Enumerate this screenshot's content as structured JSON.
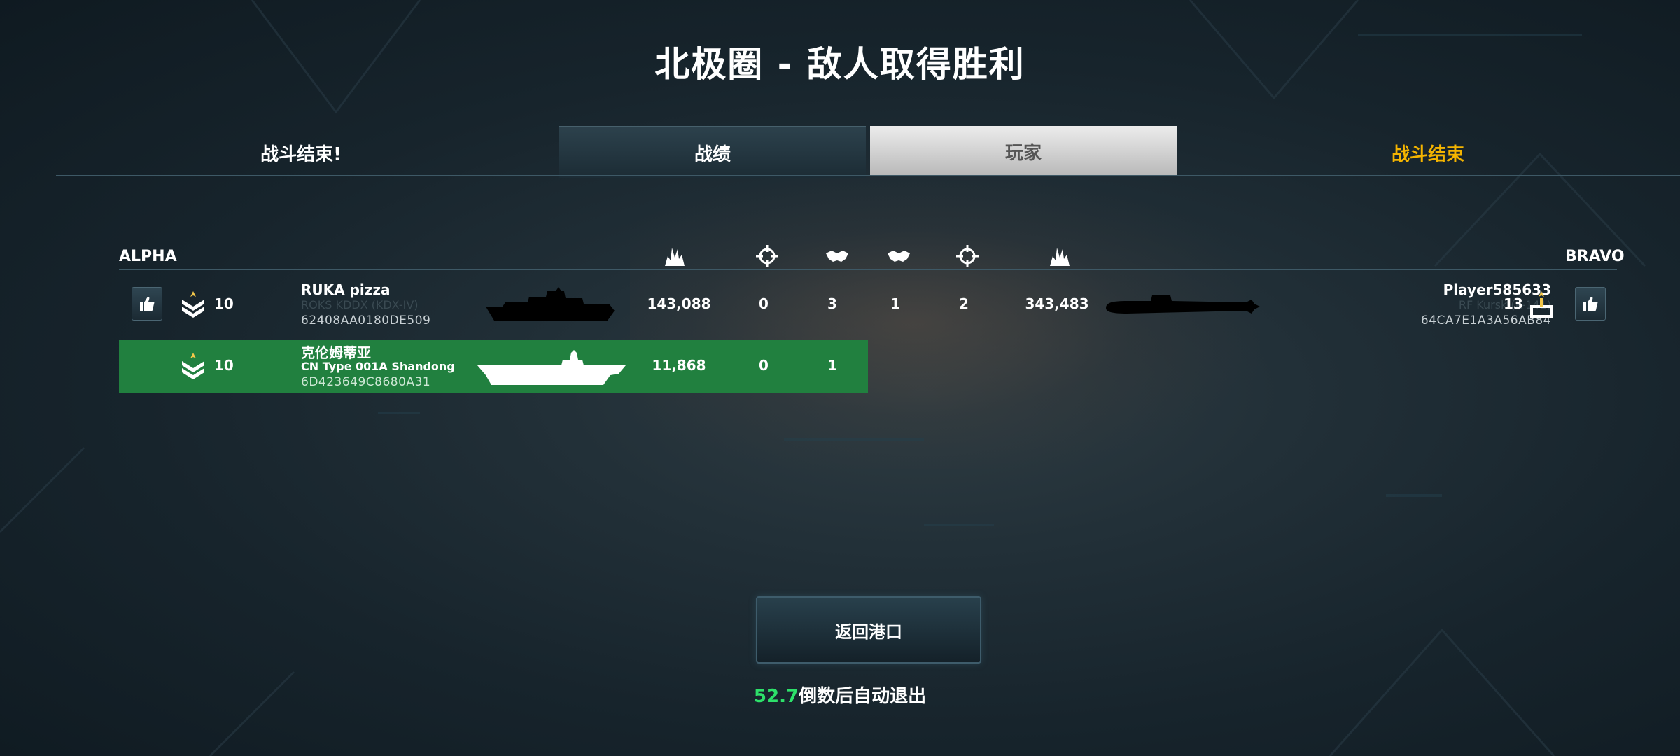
{
  "title": "北极圈 - 敌人取得胜利",
  "tabs_bar": {
    "left_label": "战斗结束!",
    "tab_stats": "战绩",
    "tab_players": "玩家",
    "right_label": "战斗结束"
  },
  "table": {
    "team_left": "ALPHA",
    "team_right": "BRAVO",
    "header_icons": [
      "damage-icon",
      "crosshair-icon",
      "handshake-icon",
      "handshake-icon",
      "crosshair-icon",
      "damage-icon"
    ],
    "rows": [
      {
        "left": {
          "rank": "10",
          "name": "RUKA pizza",
          "ship": "ROKS KDDX (KDX-IV)",
          "id": "62408AA0180DE509",
          "damage": "143,088",
          "kills": "0",
          "assists": "3"
        },
        "right": {
          "assists": "1",
          "kills": "2",
          "damage": "343,483",
          "name": "Player585633",
          "ship": "RF Kursk (K-141)",
          "id": "64CA7E1A3A56AB84",
          "rank": "13"
        }
      },
      {
        "left": {
          "rank": "10",
          "name": "克伦姆蒂亚",
          "ship": "CN Type 001A Shandong",
          "id": "6D423649C8680A31",
          "damage": "11,868",
          "kills": "0",
          "assists": "1"
        }
      }
    ]
  },
  "footer": {
    "return_button": "返回港口",
    "countdown_value": "52.7",
    "countdown_text": "倒数后自动退出"
  },
  "colors": {
    "highlight_row": "#21803f",
    "winner_label": "#f4b400",
    "countdown_number": "#2de06a"
  }
}
